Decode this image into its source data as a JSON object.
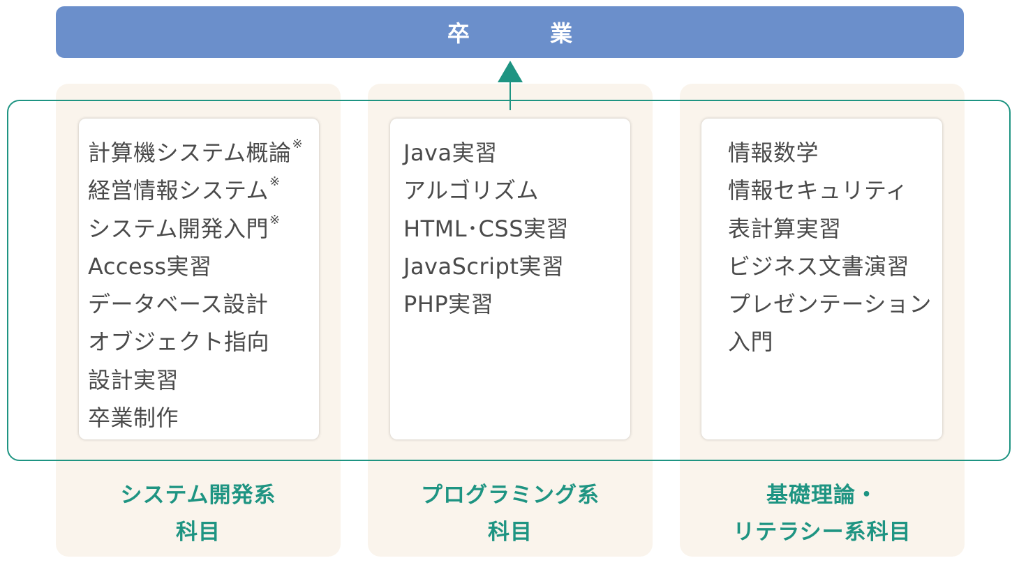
{
  "graduation": {
    "label": "卒 業"
  },
  "columns": [
    {
      "courses": [
        {
          "name": "計算機システム概論",
          "note": "※"
        },
        {
          "name": "経営情報システム",
          "note": "※"
        },
        {
          "name": "システム開発入門",
          "note": "※"
        },
        {
          "name": "Access実習",
          "note": ""
        },
        {
          "name": "データベース設計",
          "note": ""
        },
        {
          "name": "オブジェクト指向",
          "note": ""
        },
        {
          "name": "設計実習",
          "note": ""
        },
        {
          "name": "卒業制作",
          "note": ""
        }
      ],
      "category_lines": [
        "システム開発系",
        "科目"
      ]
    },
    {
      "courses": [
        {
          "name": "Java実習",
          "note": ""
        },
        {
          "name": "アルゴリズム",
          "note": ""
        },
        {
          "name": "HTML･CSS実習",
          "note": ""
        },
        {
          "name": "JavaScript実習",
          "note": ""
        },
        {
          "name": "PHP実習",
          "note": ""
        }
      ],
      "category_lines": [
        "プログラミング系",
        "科目"
      ]
    },
    {
      "courses": [
        {
          "name": "情報数学",
          "note": ""
        },
        {
          "name": "情報セキュリティ",
          "note": ""
        },
        {
          "name": "表計算実習",
          "note": ""
        },
        {
          "name": "ビジネス文書演習",
          "note": ""
        },
        {
          "name": "プレゼンテーション",
          "note": ""
        },
        {
          "name": "入門",
          "note": ""
        }
      ],
      "category_lines": [
        "基礎理論・",
        "リテラシー系科目"
      ]
    }
  ],
  "colors": {
    "graduation_bar": "#6b8fcb",
    "accent_teal": "#1e9482",
    "column_background": "#faf4ec",
    "course_text": "#4a4a4a"
  }
}
